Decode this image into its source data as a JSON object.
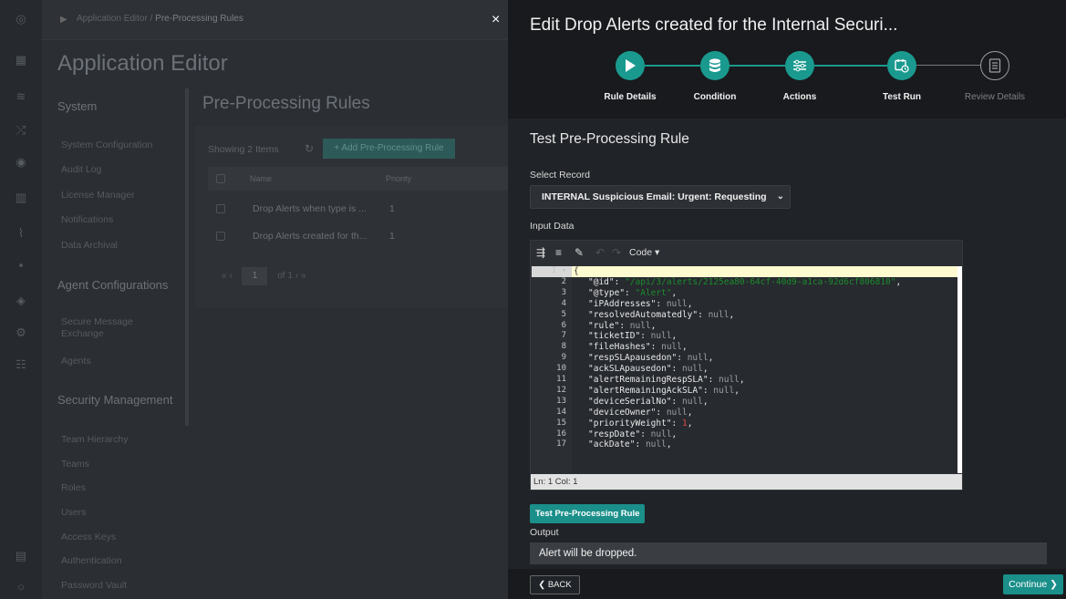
{
  "background_app": {
    "breadcrumb_parent": "Application Editor",
    "breadcrumb_current": "Pre-Processing Rules",
    "title": "Application Editor",
    "sidebar": {
      "section_system": "System",
      "system_items": [
        "System Configuration",
        "Audit Log",
        "License Manager",
        "Notifications",
        "Data Archival"
      ],
      "section_agent": "Agent Configurations",
      "agent_items": [
        "Secure Message Exchange",
        "Agents"
      ],
      "section_security": "Security Management",
      "security_items": [
        "Team Hierarchy",
        "Teams",
        "Roles",
        "Users",
        "Access Keys",
        "Authentication",
        "Password Vault"
      ]
    },
    "page_title": "Pre-Processing Rules",
    "showing_text": "Showing 2 Items",
    "add_button": "+ Add Pre-Processing Rule",
    "table": {
      "col_name": "Name",
      "col_priority": "Priority",
      "rows": [
        {
          "name": "Drop Alerts when type is ...",
          "priority": "1"
        },
        {
          "name": "Drop Alerts created for th...",
          "priority": "1"
        }
      ]
    },
    "pager": {
      "page": "1",
      "of_text": "of 1",
      "first": "«",
      "prev": "‹",
      "next": "›",
      "last": "»"
    }
  },
  "drawer": {
    "close_symbol": "×",
    "title": "Edit Drop Alerts created for the Internal Securi...",
    "steps": [
      {
        "label": "Rule Details",
        "icon": "play-icon",
        "done": true
      },
      {
        "label": "Condition",
        "icon": "database-icon",
        "done": true
      },
      {
        "label": "Actions",
        "icon": "sliders-icon",
        "done": true
      },
      {
        "label": "Test Run",
        "icon": "calendar-clock-icon",
        "done": true
      },
      {
        "label": "Review Details",
        "icon": "document-icon",
        "done": false
      }
    ],
    "section_title": "Test Pre-Processing Rule",
    "select_label": "Select Record",
    "select_value": "INTERNAL Suspicious Email: Urgent: Requesting",
    "input_label": "Input Data",
    "editor": {
      "mode_label": "Code ▾",
      "first_line": "{",
      "lines": [
        {
          "n": "2",
          "key": "\"@id\"",
          "val": "\"/api/3/alerts/2125ea80-64cf-40d9-a1ca-92d6cf806810\"",
          "type": "s"
        },
        {
          "n": "3",
          "key": "\"@type\"",
          "val": "\"Alert\"",
          "type": "s"
        },
        {
          "n": "4",
          "key": "\"iPAddresses\"",
          "val": "null",
          "type": "n"
        },
        {
          "n": "5",
          "key": "\"resolvedAutomatedly\"",
          "val": "null",
          "type": "n"
        },
        {
          "n": "6",
          "key": "\"rule\"",
          "val": "null",
          "type": "n"
        },
        {
          "n": "7",
          "key": "\"ticketID\"",
          "val": "null",
          "type": "n"
        },
        {
          "n": "8",
          "key": "\"fileHashes\"",
          "val": "null",
          "type": "n"
        },
        {
          "n": "9",
          "key": "\"respSLApausedon\"",
          "val": "null",
          "type": "n"
        },
        {
          "n": "10",
          "key": "\"ackSLApausedon\"",
          "val": "null",
          "type": "n"
        },
        {
          "n": "11",
          "key": "\"alertRemainingRespSLA\"",
          "val": "null",
          "type": "n"
        },
        {
          "n": "12",
          "key": "\"alertRemainingAckSLA\"",
          "val": "null",
          "type": "n"
        },
        {
          "n": "13",
          "key": "\"deviceSerialNo\"",
          "val": "null",
          "type": "n"
        },
        {
          "n": "14",
          "key": "\"deviceOwner\"",
          "val": "null",
          "type": "n"
        },
        {
          "n": "15",
          "key": "\"priorityWeight\"",
          "val": "1",
          "type": "num"
        },
        {
          "n": "16",
          "key": "\"respDate\"",
          "val": "null",
          "type": "n"
        },
        {
          "n": "17",
          "key": "\"ackDate\"",
          "val": "null",
          "type": "n"
        }
      ],
      "status": "Ln: 1   Col: 1"
    },
    "test_button": "Test Pre-Processing Rule",
    "output_label": "Output",
    "output_value": "Alert will be dropped.",
    "back_button": "❮ BACK",
    "continue_button": "Continue ❯"
  },
  "colors": {
    "accent": "#1a9a8f",
    "string": "#1c8c2c",
    "number": "#e04848"
  }
}
